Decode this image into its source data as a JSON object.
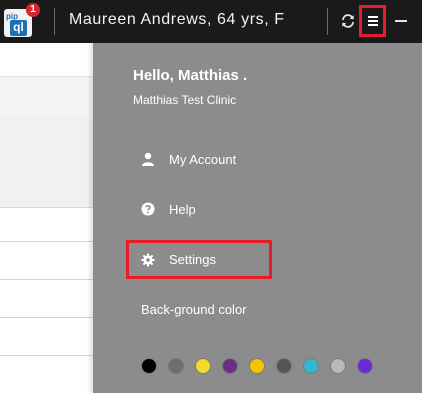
{
  "app": {
    "logo_small": "pip",
    "logo_main": "ql",
    "notification_count": "1"
  },
  "header": {
    "patient": "Maureen Andrews, 64 yrs, F",
    "icons": [
      "refresh-icon",
      "menu-icon",
      "minimize-icon"
    ]
  },
  "menu": {
    "greeting": "Hello, Matthias .",
    "clinic": "Matthias Test Clinic",
    "items": [
      {
        "label": "My Account",
        "icon": "user-icon"
      },
      {
        "label": "Help",
        "icon": "help-icon"
      },
      {
        "label": "Settings",
        "icon": "gear-icon"
      }
    ],
    "background_color_label": "Back-ground color",
    "swatches": [
      "#000000",
      "#6e6e6e",
      "#f5d92a",
      "#6d2f86",
      "#f5c400",
      "#555555",
      "#2fb8d0",
      "#b8b8b8",
      "#6a2bd6"
    ]
  },
  "colors": {
    "topbar": "#1a1a1a",
    "panel": "#8c8c8c",
    "highlight": "#e81c2a"
  }
}
